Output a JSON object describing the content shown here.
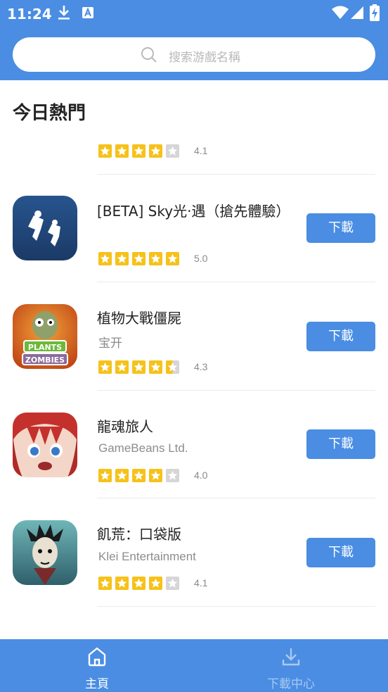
{
  "status_bar": {
    "time": "11:24",
    "icons": [
      "download-icon",
      "a-notification-icon",
      "wifi-icon",
      "signal-icon",
      "battery-icon"
    ]
  },
  "search": {
    "placeholder": "搜索游戲名稱",
    "icon": "search-icon"
  },
  "section_title": "今日熱門",
  "partial_item": {
    "rating": "4.1",
    "stars": 4
  },
  "apps": [
    {
      "name": "[BETA] Sky光·遇（搶先體驗）",
      "developer": "",
      "rating": "5.0",
      "stars": 5,
      "button": "下載",
      "icon": "sky-app-icon"
    },
    {
      "name": "植物大戰僵屍",
      "developer": "宝开",
      "rating": "4.3",
      "stars": 4.5,
      "button": "下載",
      "icon": "plants-vs-zombies-app-icon"
    },
    {
      "name": "龍魂旅人",
      "developer": "GameBeans Ltd.",
      "rating": "4.0",
      "stars": 4,
      "button": "下載",
      "icon": "dragon-soul-app-icon"
    },
    {
      "name": "飢荒：口袋版",
      "developer": "Klei Entertainment",
      "rating": "4.1",
      "stars": 4,
      "button": "下載",
      "icon": "dont-starve-app-icon"
    }
  ],
  "colors": {
    "primary": "#4a8de3",
    "star_filled": "#f6c21a",
    "star_empty": "#d6d6d6"
  },
  "bottom_nav": {
    "items": [
      {
        "label": "主頁",
        "icon": "home-icon",
        "active": true
      },
      {
        "label": "下載中心",
        "icon": "download-center-icon",
        "active": false
      }
    ]
  }
}
